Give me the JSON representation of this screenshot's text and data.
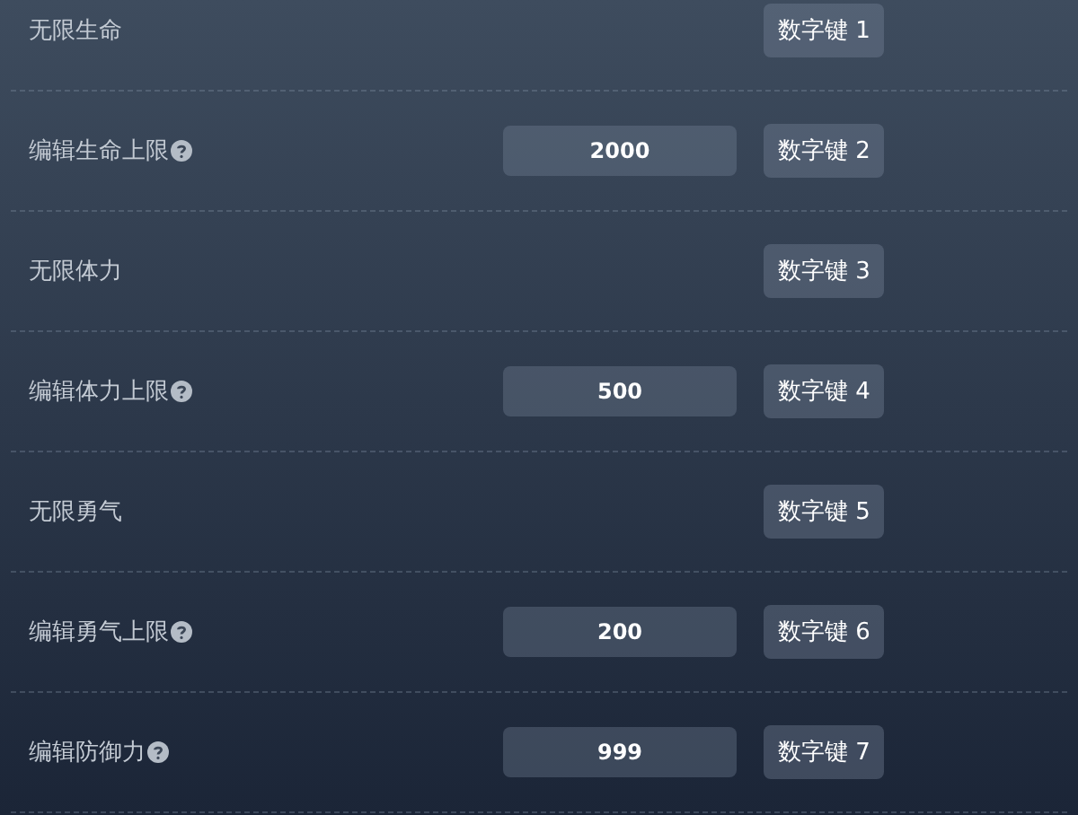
{
  "rows": [
    {
      "kind": "toggle",
      "label": "无限生命",
      "hotkey": "数字键 1"
    },
    {
      "kind": "input",
      "label": "编辑生命上限",
      "help": true,
      "value": "2000",
      "hotkey": "数字键 2"
    },
    {
      "kind": "toggle",
      "label": "无限体力",
      "hotkey": "数字键 3"
    },
    {
      "kind": "input",
      "label": "编辑体力上限",
      "help": true,
      "value": "500",
      "hotkey": "数字键 4"
    },
    {
      "kind": "toggle",
      "label": "无限勇气",
      "hotkey": "数字键 5"
    },
    {
      "kind": "input",
      "label": "编辑勇气上限",
      "help": true,
      "value": "200",
      "hotkey": "数字键 6"
    },
    {
      "kind": "input",
      "label": "编辑防御力",
      "help": true,
      "value": "999",
      "hotkey": "数字键 7"
    }
  ]
}
